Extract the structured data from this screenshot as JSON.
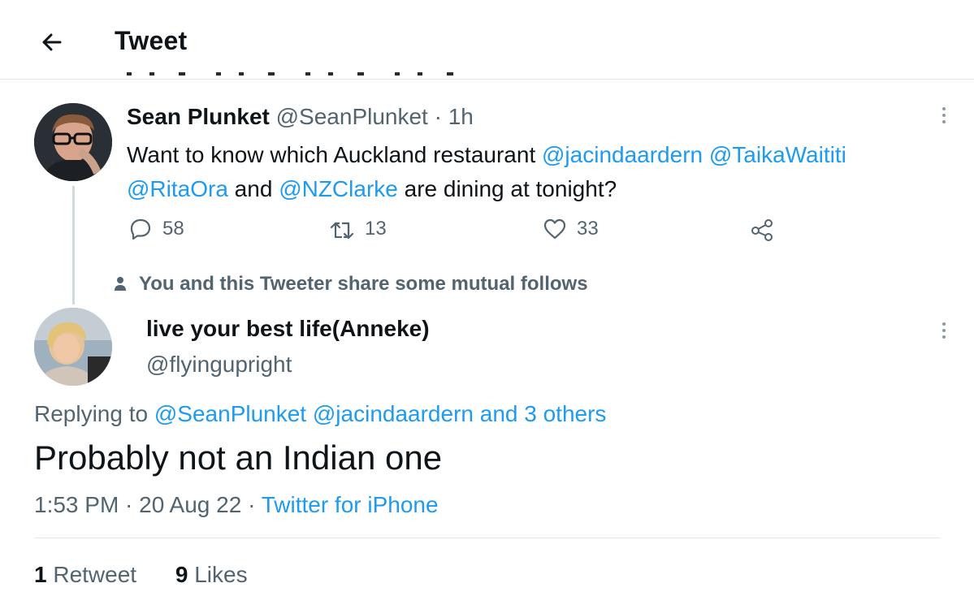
{
  "header": {
    "title": "Tweet"
  },
  "tweet1": {
    "name": "Sean Plunket",
    "handle": "@SeanPlunket",
    "separator": " · ",
    "time": "1h",
    "text_1": "Want to know which Auckland restaurant ",
    "mention_1": "@jacindaardern",
    "mention_2": "@TaikaWaititi",
    "mention_3": "@RitaOra",
    "text_2": " and ",
    "mention_4": "@NZClarke",
    "text_3": " are dining at tonight?",
    "replies": "58",
    "retweets": "13",
    "likes": "33"
  },
  "mutual_notice": "You and this Tweeter share some mutual follows",
  "tweet2": {
    "name": "live your best life(Anneke)",
    "handle": "@flyingupright",
    "replying_prefix": "Replying to ",
    "replying_to_1": "@SeanPlunket",
    "replying_to_2": "@jacindaardern",
    "replying_and": "and 3 others",
    "text": "Probably not an Indian one",
    "timestamp": "1:53 PM",
    "date": "20 Aug 22",
    "dot": " · ",
    "source": "Twitter for iPhone"
  },
  "stats": {
    "retweets_count": "1",
    "retweets_label": "Retweet",
    "likes_count": "9",
    "likes_label": "Likes"
  },
  "colors": {
    "link": "#1d9bf0",
    "secondary_text": "#536471",
    "primary_text": "#0f1419",
    "divider": "#e1e6ea"
  },
  "icons": [
    "back-arrow-icon",
    "more-icon",
    "reply-icon",
    "retweet-icon",
    "like-icon",
    "share-icon",
    "person-icon"
  ]
}
